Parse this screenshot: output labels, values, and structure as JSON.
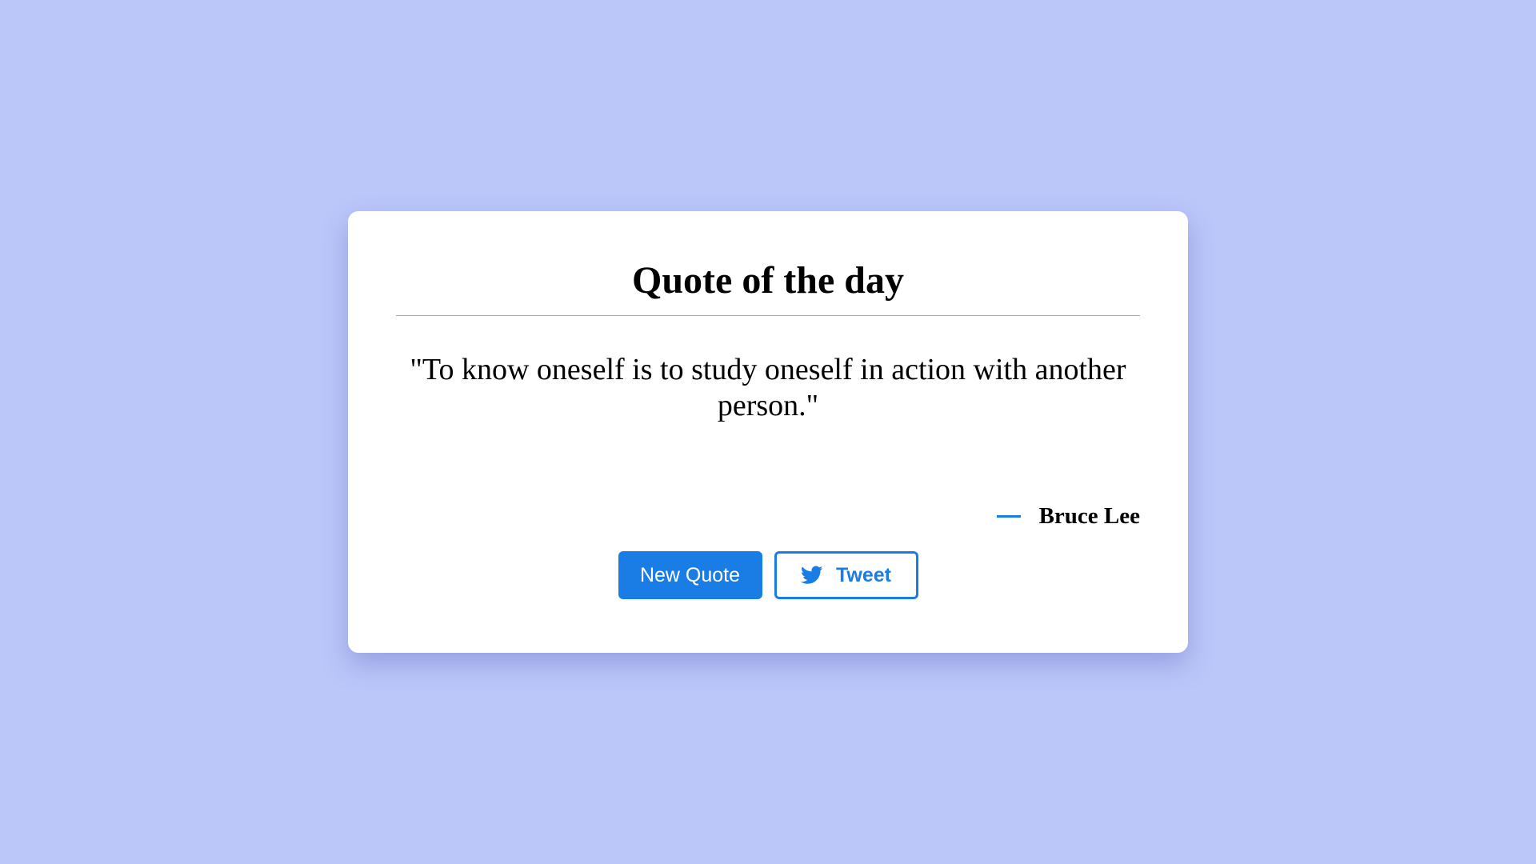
{
  "card": {
    "title": "Quote of the day",
    "quote": "\"To know oneself is to study oneself in action with another person.\"",
    "author_dash": "—",
    "author": "Bruce Lee"
  },
  "buttons": {
    "new_quote_label": "New Quote",
    "tweet_label": "Tweet",
    "tweet_icon": "twitter-bird-icon"
  },
  "colors": {
    "background": "#bbc6f9",
    "card": "#ffffff",
    "accent": "#1a7de6",
    "text": "#000000"
  }
}
